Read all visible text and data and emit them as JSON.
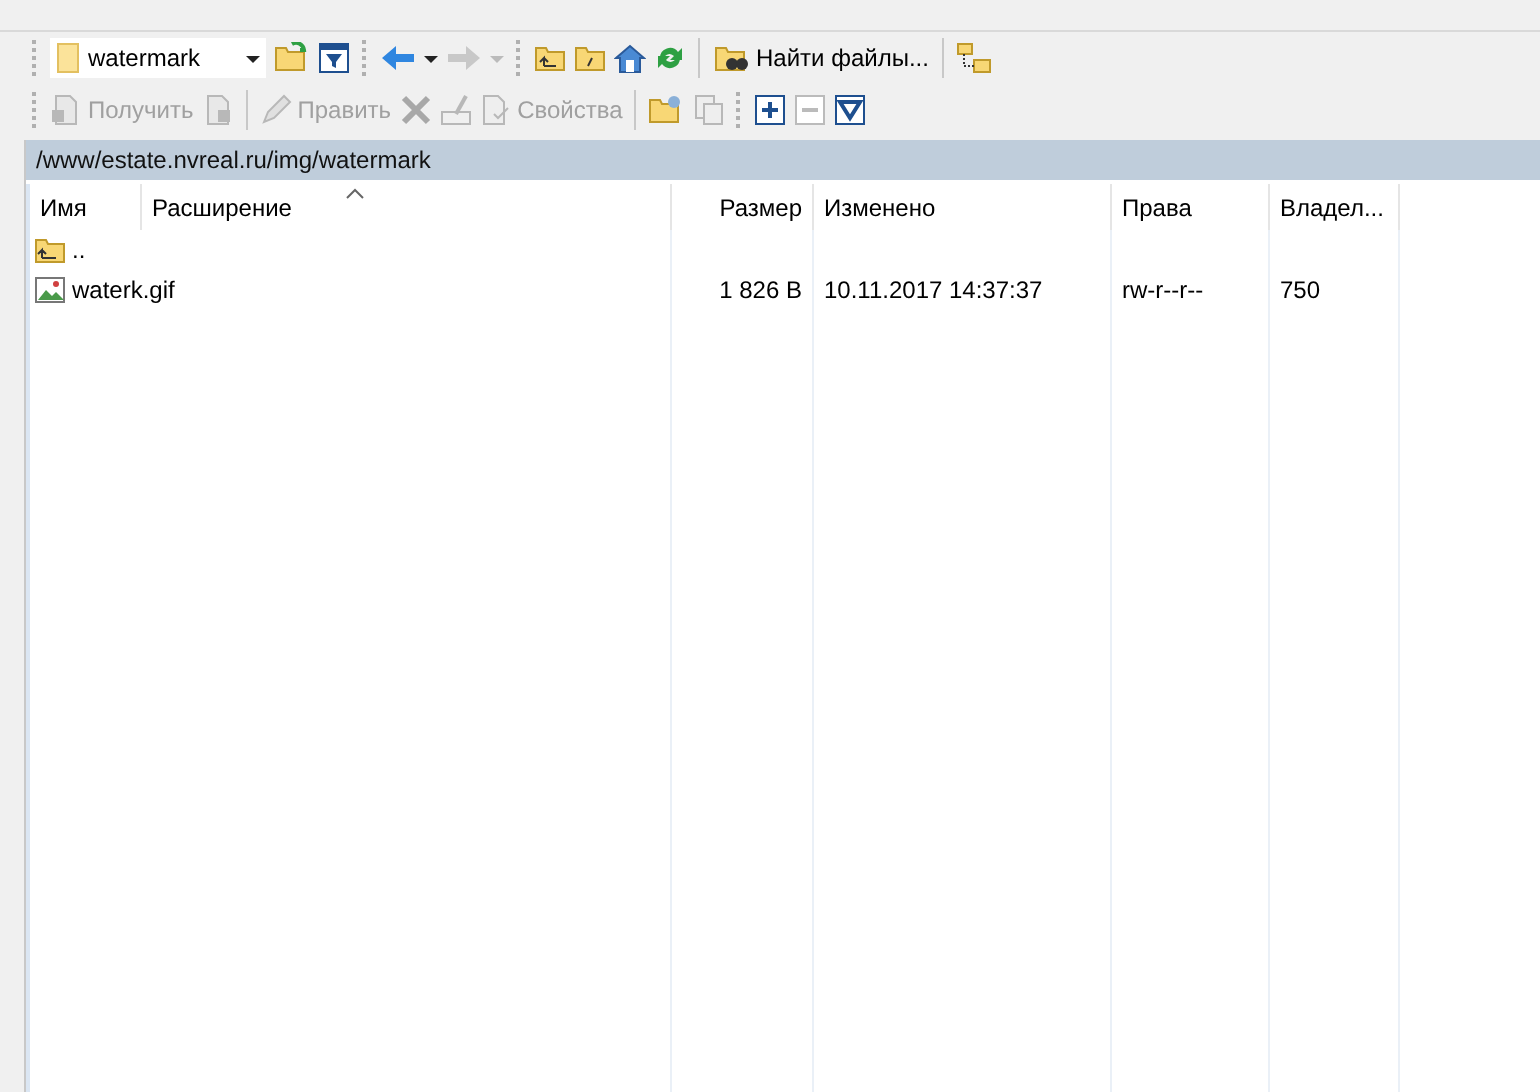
{
  "toolbar": {
    "location": "watermark",
    "find_button": "Найти файлы..."
  },
  "command_bar": {
    "buttons": [
      {
        "label": "Получить",
        "disabled": true
      },
      {
        "label": "Править",
        "disabled": true
      },
      {
        "label": "Свойства",
        "disabled": true
      }
    ]
  },
  "path": "/www/estate.nvreal.ru/img/watermark",
  "columns": [
    {
      "label": "Имя",
      "sorted": false
    },
    {
      "label": "Расширение",
      "sorted": true
    },
    {
      "label": "Размер",
      "sorted": false
    },
    {
      "label": "Изменено",
      "sorted": false
    },
    {
      "label": "Права",
      "sorted": false
    },
    {
      "label": "Владел...",
      "sorted": false
    }
  ],
  "rows": [
    {
      "kind": "parent",
      "name": "..",
      "selected": false
    },
    {
      "kind": "file",
      "name": "waterk.gif",
      "size": "1 826 B",
      "modified": "10.11.2017 14:37:37",
      "rights": "rw-r--r--",
      "owner": "750",
      "selected": false
    }
  ]
}
